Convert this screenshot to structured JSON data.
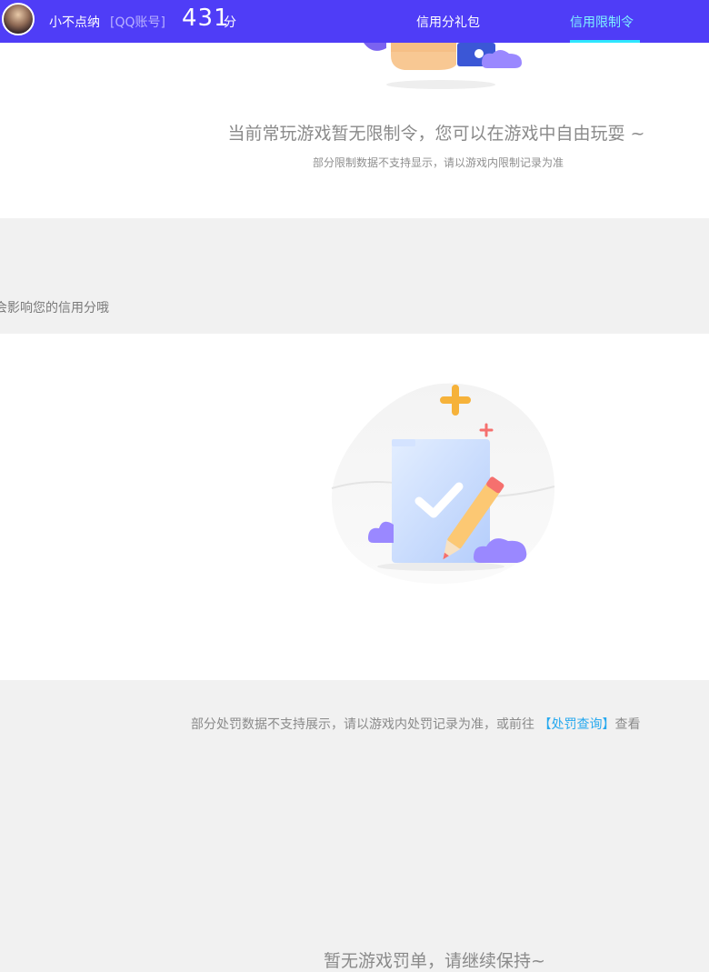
{
  "header": {
    "username": "小不点纳",
    "account_type": "[QQ账号]",
    "score": "431",
    "score_unit": "分",
    "tabs": [
      {
        "label": "信用分礼包",
        "active": false
      },
      {
        "label": "信用限制令",
        "active": true
      }
    ]
  },
  "limits": {
    "message": "当前常玩游戏暂无限制令，您可以在游戏中自由玩耍 ~",
    "note": "部分限制数据不支持显示，请以游戏内限制记录为准"
  },
  "credit_note": "会影响您的信用分哦",
  "penalties": {
    "message": "暂无游戏罚单，请继续保持~",
    "note_prefix": "部分处罚数据不支持展示，请以游戏内处罚记录为准，或前往",
    "link_label": "【处罚查询】",
    "note_suffix": "查看"
  },
  "colors": {
    "topbar": "#4f3df7",
    "active_tab": "#7ff3ff",
    "link": "#27a9ef"
  }
}
